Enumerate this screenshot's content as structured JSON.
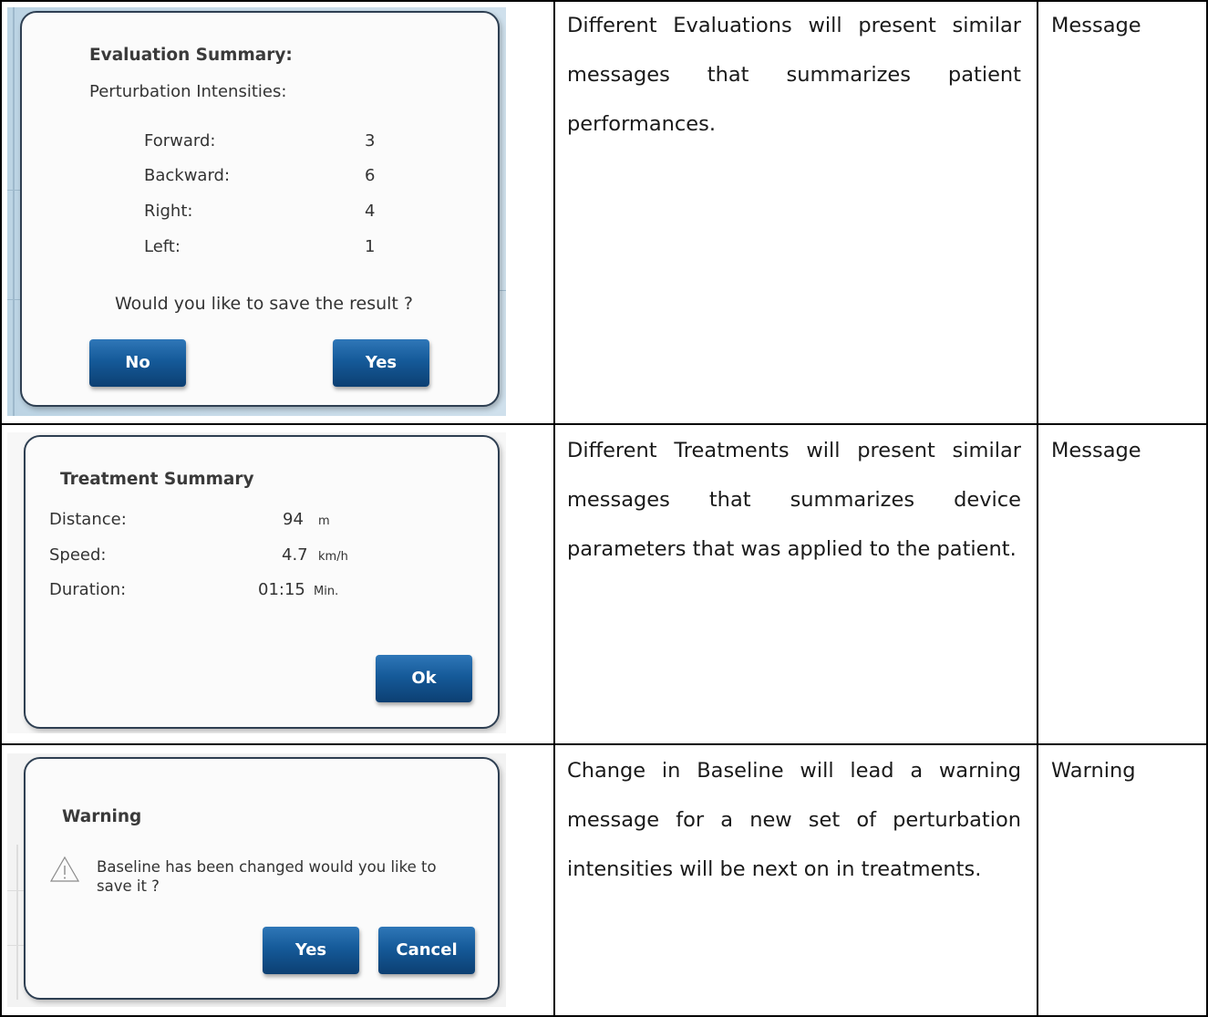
{
  "rows": [
    {
      "dialog": {
        "title": "Evaluation Summary:",
        "subtitle": "Perturbation Intensities:",
        "items": [
          {
            "label": "Forward:",
            "value": "3"
          },
          {
            "label": "Backward:",
            "value": "6"
          },
          {
            "label": "Right:",
            "value": "4"
          },
          {
            "label": "Left:",
            "value": "1"
          }
        ],
        "question": "Would you like to save the result ?",
        "buttons": {
          "no": "No",
          "yes": "Yes"
        }
      },
      "description": "Different Evaluations will present similar messages that summarizes patient performances.",
      "type": "Message"
    },
    {
      "dialog": {
        "title": "Treatment Summary",
        "items": [
          {
            "label": "Distance:",
            "value": "94",
            "unit": "m"
          },
          {
            "label": "Speed:",
            "value": "4.7",
            "unit": "km/h"
          },
          {
            "label": "Duration:",
            "value": "01:15",
            "unit": "Min."
          }
        ],
        "buttons": {
          "ok": "Ok"
        }
      },
      "description": "Different Treatments will present similar messages that summarizes device parameters that was applied to the patient.",
      "type": "Message"
    },
    {
      "dialog": {
        "title": "Warning",
        "icon": "warning-triangle-icon",
        "message": "Baseline has been changed would you like to save it ?",
        "buttons": {
          "yes": "Yes",
          "cancel": "Cancel"
        }
      },
      "description": "Change in Baseline will lead a warning message for a new set of perturbation intensities will be next on in treatments.",
      "type": "Warning"
    }
  ]
}
